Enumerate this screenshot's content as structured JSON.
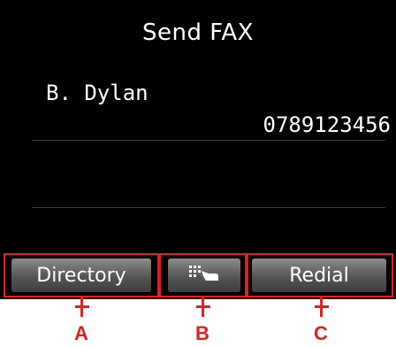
{
  "screen": {
    "title": "Send FAX",
    "recipient": {
      "name": "B. Dylan",
      "number": "0789123456"
    }
  },
  "buttons": {
    "directory_label": "Directory",
    "keypad_icon": "keypad-hand-icon",
    "redial_label": "Redial"
  },
  "callouts": {
    "a": "A",
    "b": "B",
    "c": "C"
  },
  "colors": {
    "screen_bg": "#000000",
    "text": "#ffffff",
    "button": "#5a5a5a",
    "callout_red": "#e02020"
  }
}
